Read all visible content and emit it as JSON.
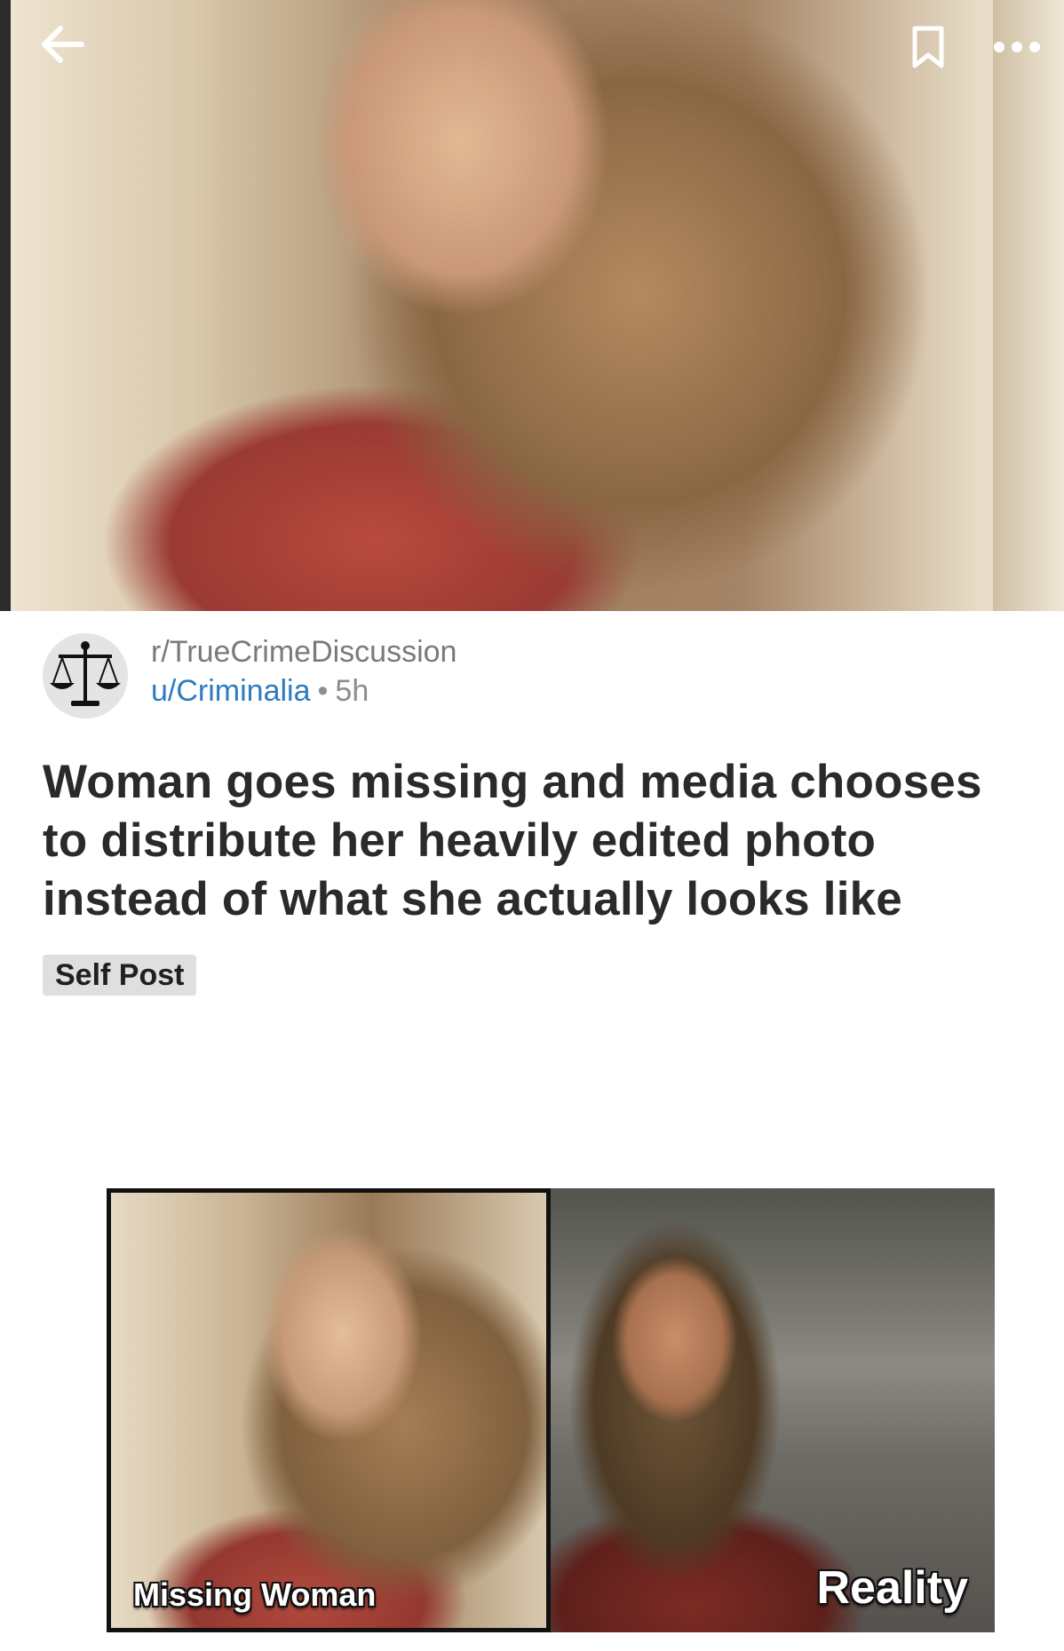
{
  "header": {
    "back_icon": "arrow-left-icon",
    "bookmark_icon": "bookmark-icon",
    "more_icon": "more-horizontal-icon"
  },
  "post": {
    "subreddit": "r/TrueCrimeDiscussion",
    "username": "u/Criminalia",
    "separator": "•",
    "age": "5h",
    "title": "Woman goes missing and media chooses to distribute her heavily edited photo instead of what she actually looks like",
    "flair": "Self Post"
  },
  "comparison_image": {
    "left_caption": "Missing Woman",
    "right_caption": "Reality"
  },
  "colors": {
    "username_link": "#2f7bc0",
    "meta_gray": "#8a8d91",
    "title_text": "#2a2a2b",
    "flair_bg": "#dfdfe0"
  }
}
